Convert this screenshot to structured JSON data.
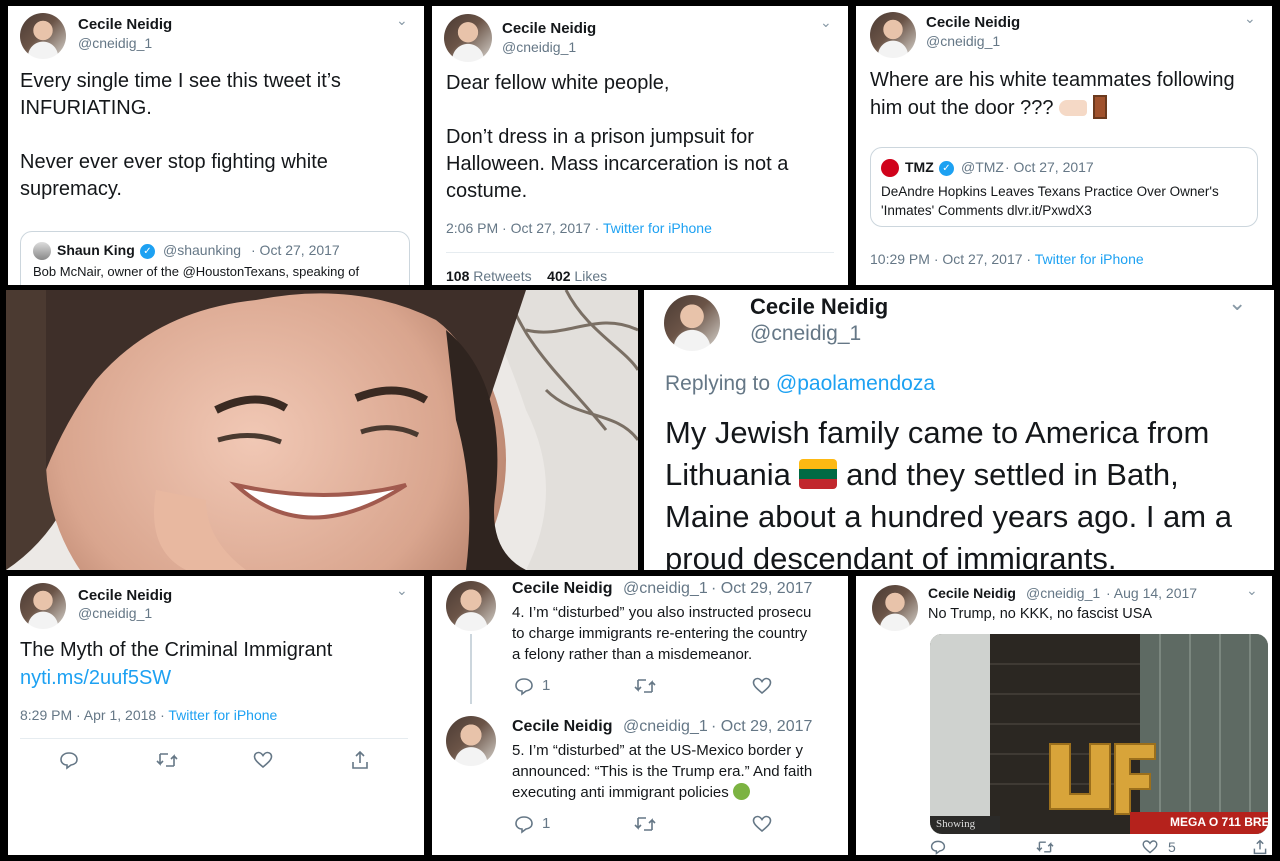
{
  "user": {
    "name": "Cecile Neidig",
    "handle": "@cneidig_1"
  },
  "panel1": {
    "text": "Every single time I see this tweet it’s\nINFURIATING.\n\nNever ever ever stop fighting white\nsupremacy.",
    "quote": {
      "name": "Shaun King",
      "handle": "@shaunking",
      "date": "· Oct 27, 2017",
      "text": "Bob McNair, owner of the @HoustonTexans, speaking of"
    }
  },
  "panel2": {
    "text": "Dear fellow white people,\n\nDon’t dress in a prison jumpsuit for\nHalloween. Mass incarceration is not a\ncostume.",
    "time": "2:06 PM · Oct 27, 2017 · ",
    "source": "Twitter for iPhone",
    "retweets_count": "108",
    "retweets_label": "Retweets",
    "likes_count": "402",
    "likes_label": "Likes"
  },
  "panel3": {
    "text": "Where are his white teammates following\nhim out the door ???",
    "quote": {
      "name": "TMZ",
      "handle": "@TMZ",
      "date": "· Oct 27, 2017",
      "text": "DeAndre Hopkins Leaves Texans Practice Over Owner's\n'Inmates' Comments dlvr.it/PxwdX3"
    },
    "time": "10:29 PM · Oct 27, 2017 · ",
    "source": "Twitter for iPhone"
  },
  "panel5": {
    "replying_label": "Replying to ",
    "replying_handle": "@paolamendoza",
    "text_a": "My Jewish family came to America from\nLithuania ",
    "text_b": " and they settled in Bath,\nMaine about a hundred years ago. I am a\nproud descendant of immigrants."
  },
  "panel6": {
    "title": "The Myth of the Criminal Immigrant",
    "link": "nyti.ms/2uuf5SW",
    "time": "8:29 PM · Apr 1, 2018 · ",
    "source": "Twitter for iPhone"
  },
  "panel7": {
    "tweet1": {
      "date": "· Oct 29, 2017",
      "text": "4. I’m “disturbed” you also instructed prosecu\nto charge immigrants re-entering the country\na felony rather than a misdemeanor.",
      "replies": "1"
    },
    "tweet2": {
      "date": "· Oct 29, 2017",
      "text": "5. I’m “disturbed” at the US-Mexico border y\nannounced: “This is the Trump era.” And faith\nexecuting anti immigrant policies",
      "replies": "1"
    }
  },
  "panel8": {
    "date": "· Aug 14, 2017",
    "text": "No Trump, no KKK, no fascist USA",
    "likes": "5",
    "photo_caption_left": "Showing",
    "photo_caption_right": "MEGA O 711 BRE"
  },
  "colors": {
    "link": "#1da1f2",
    "muted": "#657786",
    "text": "#14171a",
    "border": "#ccd6dd"
  },
  "icons": [
    "chevron-down-icon",
    "verified-icon",
    "reply-icon",
    "retweet-icon",
    "like-icon",
    "share-icon",
    "pointing-hand-icon",
    "door-icon",
    "flag-lithuania-icon",
    "nauseated-face-icon"
  ]
}
